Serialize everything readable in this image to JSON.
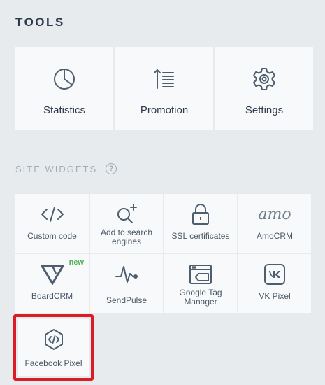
{
  "tools": {
    "title": "TOOLS",
    "items": [
      {
        "label": "Statistics",
        "icon": "pie-chart-icon"
      },
      {
        "label": "Promotion",
        "icon": "sort-list-icon"
      },
      {
        "label": "Settings",
        "icon": "gear-icon"
      }
    ]
  },
  "widgets": {
    "title": "SITE WIDGETS",
    "help": "?",
    "items": [
      {
        "label": "Custom code",
        "icon": "code-icon"
      },
      {
        "label": "Add to search engines",
        "icon": "search-plus-icon"
      },
      {
        "label": "SSL certificates",
        "icon": "lock-icon"
      },
      {
        "label": "AmoCRM",
        "icon": "amocrm-logo-icon",
        "logo_text": "amo"
      },
      {
        "label": "BoardCRM",
        "icon": "boardcrm-logo-icon",
        "badge": "new"
      },
      {
        "label": "SendPulse",
        "icon": "pulse-icon"
      },
      {
        "label": "Google Tag Manager",
        "icon": "browser-tag-icon"
      },
      {
        "label": "VK Pixel",
        "icon": "vk-logo-icon"
      },
      {
        "label": "Facebook Pixel",
        "icon": "hexagon-code-icon",
        "highlighted": true
      }
    ]
  },
  "colors": {
    "background": "#e8ebee",
    "tile": "#f8f9fb",
    "heading": "#2c3a4a",
    "muted": "#a2acb6",
    "icon": "#4e5e6e",
    "new_badge": "#4caf50",
    "highlight": "#dd1b26"
  }
}
